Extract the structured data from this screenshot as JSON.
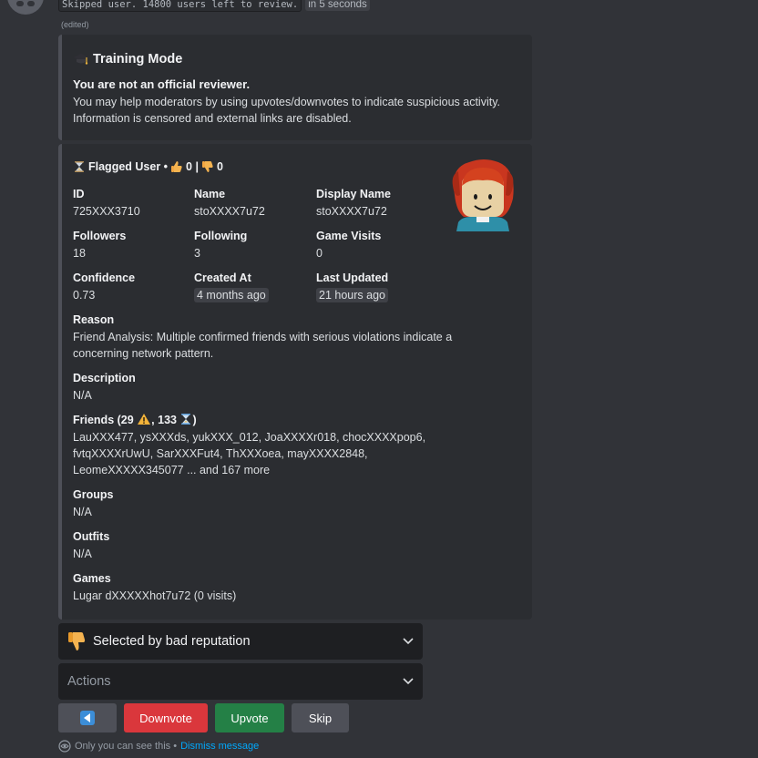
{
  "message": {
    "status_code": "Skipped user. 14800 users left to review.",
    "time_chip": "in 5 seconds",
    "edited": "(edited)"
  },
  "training": {
    "title": "Training Mode",
    "bold": "You are not an official reviewer.",
    "body": "You may help moderators by using upvotes/downvotes to indicate suspicious activity. Information is censored and external links are disabled."
  },
  "flagged": {
    "title": "Flagged User •",
    "upvotes": "0 |",
    "downvotes": "0",
    "fields": {
      "id_label": "ID",
      "id": "725XXX3710",
      "name_label": "Name",
      "name": "stoXXXX7u72",
      "display_label": "Display Name",
      "display": "stoXXXX7u72",
      "followers_label": "Followers",
      "followers": "18",
      "following_label": "Following",
      "following": "3",
      "visits_label": "Game Visits",
      "visits": "0",
      "confidence_label": "Confidence",
      "confidence": "0.73",
      "created_label": "Created At",
      "created": "4 months ago",
      "updated_label": "Last Updated",
      "updated": "21 hours ago"
    },
    "reason_label": "Reason",
    "reason": "Friend Analysis: Multiple confirmed friends with serious violations indicate a concerning network pattern.",
    "description_label": "Description",
    "description": "N/A",
    "friends_label_prefix": "Friends (29",
    "friends_label_mid": ", 133",
    "friends_label_suffix": ")",
    "friends": "LauXXX477, ysXXXds, yukXXX_012, JoaXXXXr018, chocXXXXpop6, fvtqXXXXrUwU, SarXXXFut4, ThXXXoea, mayXXXX2848, LeomeXXXXX345077 ... and 167 more",
    "groups_label": "Groups",
    "groups": "N/A",
    "outfits_label": "Outfits",
    "outfits": "N/A",
    "games_label": "Games",
    "games": "Lugar dXXXXXhot7u72 (0 visits)"
  },
  "selects": {
    "reason_value": "Selected by bad reputation",
    "actions_placeholder": "Actions"
  },
  "buttons": {
    "downvote": "Downvote",
    "upvote": "Upvote",
    "skip": "Skip"
  },
  "footer": {
    "only_you": "Only you can see this •",
    "dismiss": "Dismiss message"
  },
  "colors": {
    "background": "#313338",
    "embed": "#2b2d31",
    "danger": "#da373c",
    "success": "#248046",
    "link": "#00a8fc"
  }
}
